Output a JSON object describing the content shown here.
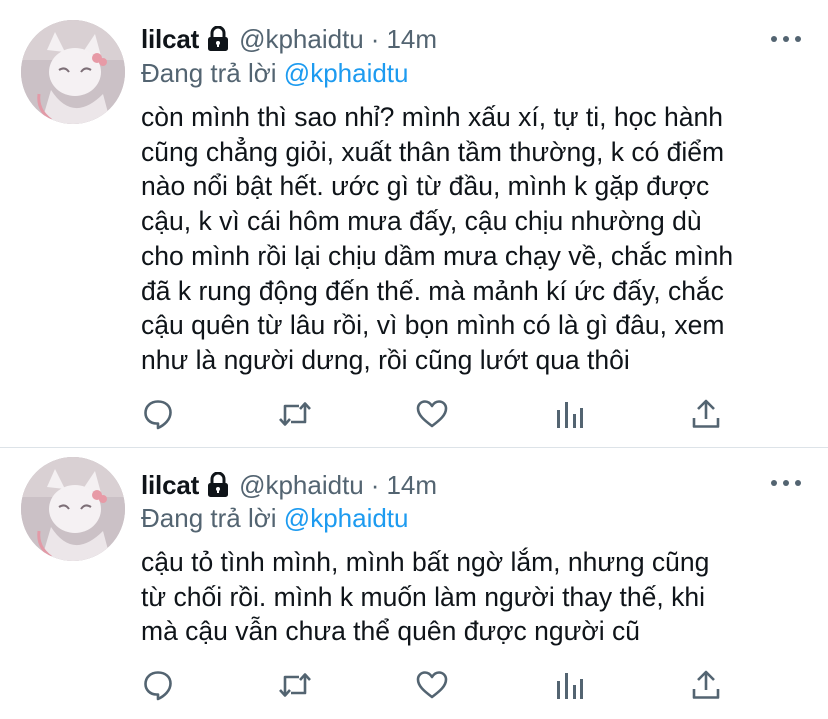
{
  "tweets": [
    {
      "display_name": "lilcat",
      "handle": "@kphaidtu",
      "separator": "·",
      "time": "14m",
      "reply_prefix": "Đang trả lời",
      "reply_handle": "@kphaidtu",
      "text": "còn mình thì sao nhỉ? mình xấu xí, tự ti, học hành\ncũng chẳng giỏi, xuất thân tầm thường, k có điểm\nnào nổi bật hết. ước gì từ đầu, mình k gặp được\ncậu, k vì cái hôm mưa đấy, cậu chịu nhường dù\ncho mình rồi lại chịu dầm mưa chạy về, chắc mình\nđã k rung động đến thế. mà mảnh kí ức đấy, chắc\ncậu quên từ lâu rồi, vì bọn mình có là gì đâu, xem\nnhư là người dưng, rồi cũng lướt qua thôi"
    },
    {
      "display_name": "lilcat",
      "handle": "@kphaidtu",
      "separator": "·",
      "time": "14m",
      "reply_prefix": "Đang trả lời",
      "reply_handle": "@kphaidtu",
      "text": "cậu tỏ tình mình, mình bất ngờ lắm, nhưng cũng\ntừ chối rồi. mình k muốn làm người thay thế, khi\nmà cậu vẫn chưa thể quên được người cũ"
    }
  ],
  "icons": {
    "lock": "lock-icon",
    "more": "more-dots-icon",
    "reply": "comment-icon",
    "retweet": "retweet-icon",
    "like": "heart-icon",
    "analytics": "bar-chart-icon",
    "share": "share-icon"
  },
  "colors": {
    "text": "#0f1419",
    "secondary": "#536471",
    "link": "#1d9bf0",
    "divider": "#dde3e8"
  }
}
